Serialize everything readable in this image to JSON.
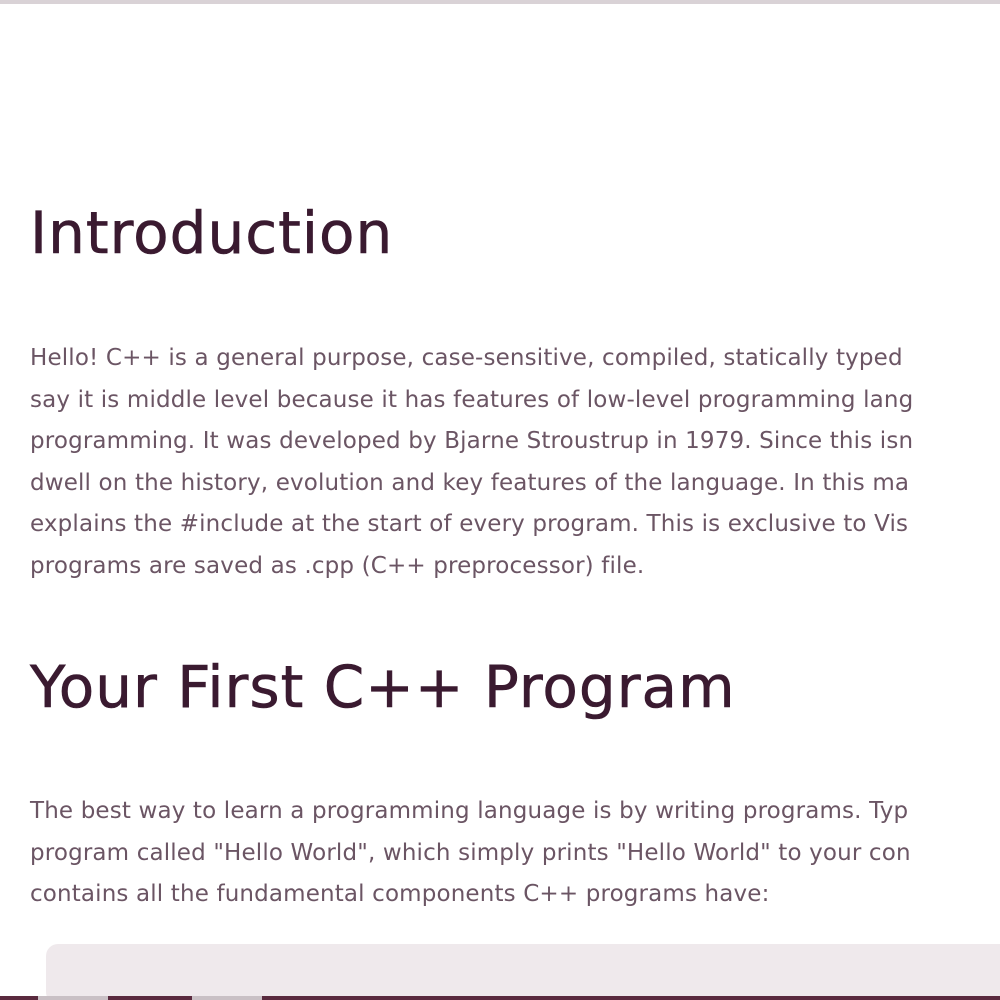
{
  "sections": {
    "introduction": {
      "heading": "Introduction",
      "lines": [
        "Hello! C++ is a general purpose, case-sensitive, compiled, statically typed",
        "say it is middle level because it has features of low-level programming lang",
        "programming. It was developed by Bjarne Stroustrup in 1979. Since this isn",
        "dwell on the history, evolution and key features of the language. In this ma",
        "explains the #include at the start of every program. This is exclusive to Vis",
        "programs are saved as .cpp (C++ preprocessor) file."
      ]
    },
    "first_program": {
      "heading": "Your First C++ Program",
      "lines": [
        "The best way to learn a programming language is by writing programs. Typ",
        "program called \"Hello World\", which simply prints \"Hello World\" to your con",
        "contains all the fundamental components C++ programs have:"
      ]
    }
  },
  "colors": {
    "heading": "#3a1a30",
    "body_text": "#6b5564",
    "code_background": "#efe9ec",
    "bottom_bar": "#5a2a3e"
  }
}
